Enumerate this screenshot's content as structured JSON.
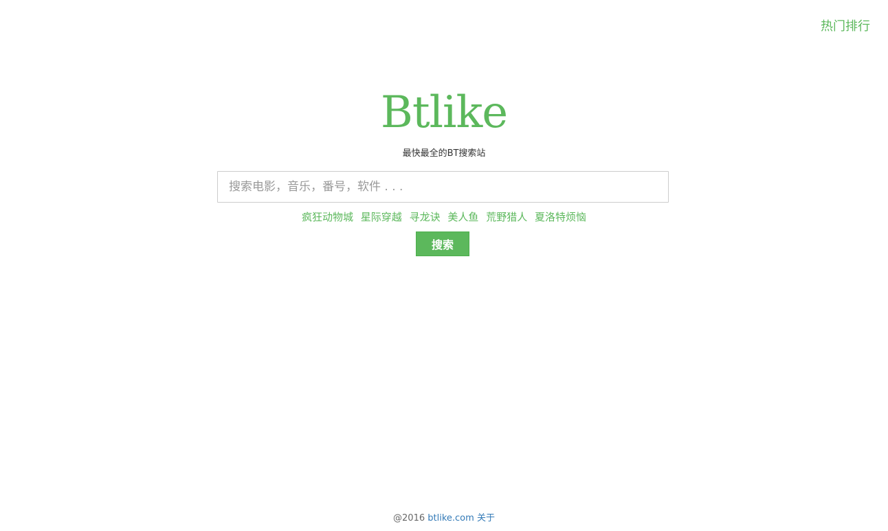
{
  "header": {
    "hot_ranking_label": "热门排行"
  },
  "brand": {
    "logo_text": "Btlike",
    "tagline": "最快最全的BT搜索站",
    "accent_color": "#5cb85c",
    "link_color": "#337ab7"
  },
  "search": {
    "value": "",
    "placeholder": "搜索电影，音乐，番号，软件 . . .",
    "button_label": "搜索"
  },
  "hot_keywords": [
    "疯狂动物城",
    "星际穿越",
    "寻龙诀",
    "美人鱼",
    "荒野猎人",
    "夏洛特烦恼"
  ],
  "footer": {
    "copyright": "@2016",
    "site_link": "btlike.com",
    "about_link": "关于"
  }
}
